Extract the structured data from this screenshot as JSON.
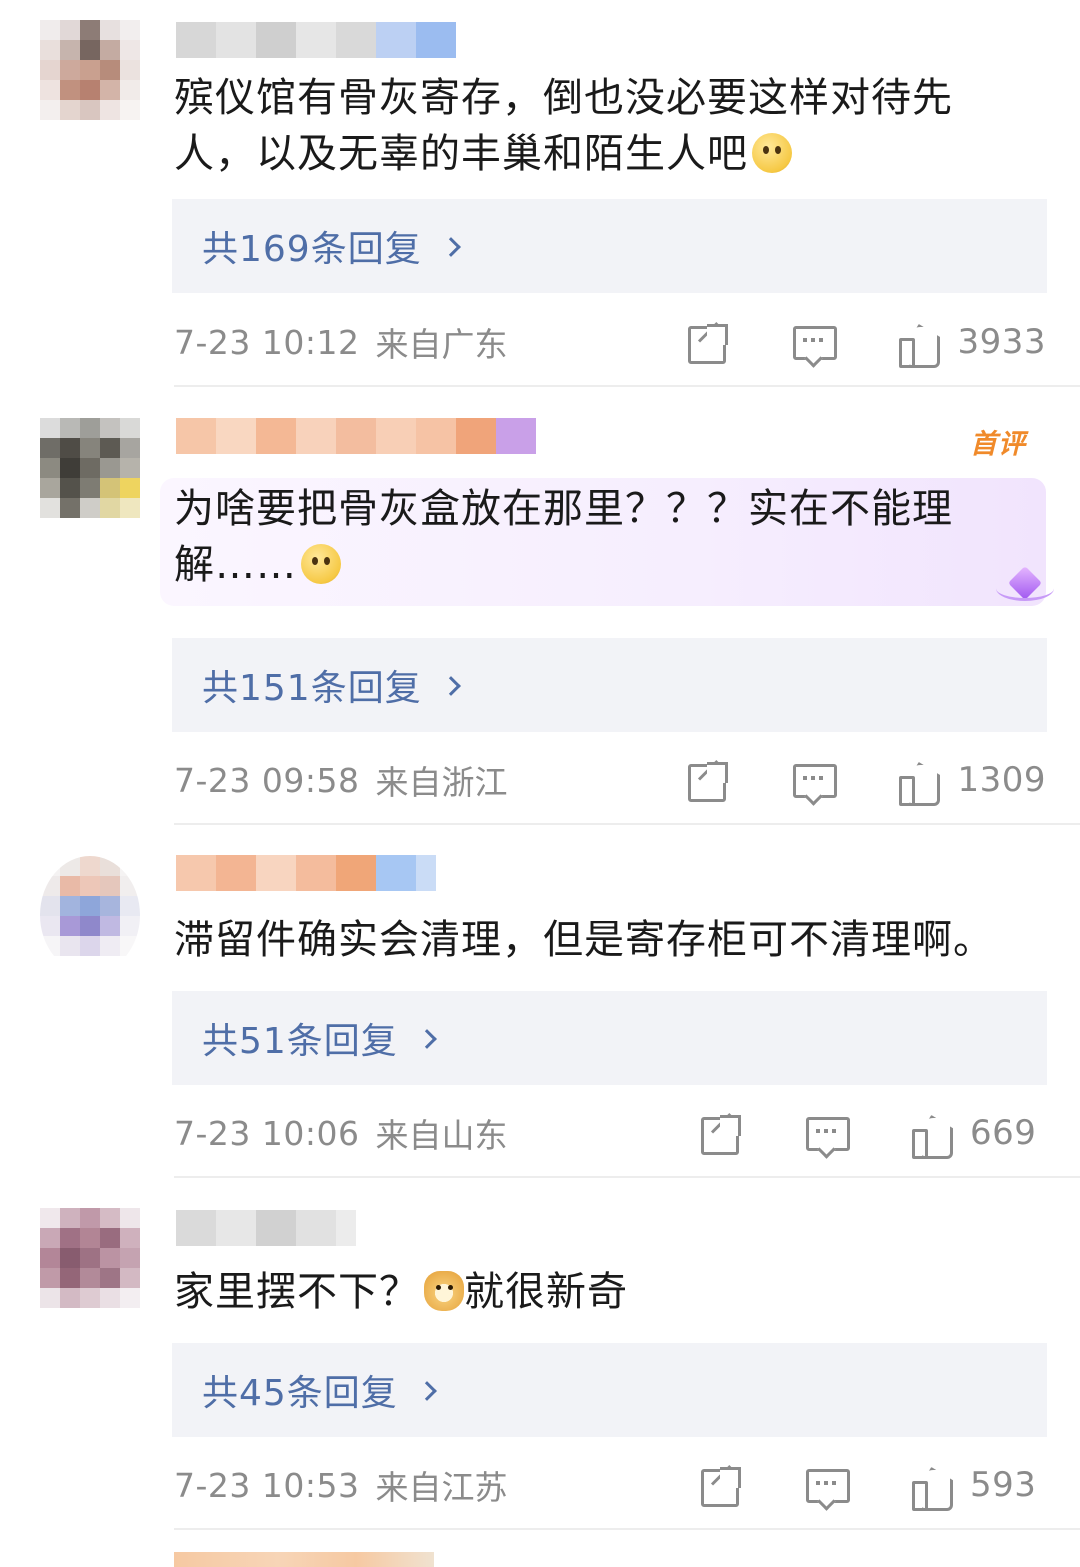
{
  "comments": [
    {
      "text": "殡仪馆有骨灰寄存，倒也没必要这样对待先人，以及无辜的丰巢和陌生人吧",
      "emoji": "thinking-emoji",
      "replies_label": "共169条回复",
      "time": "7-23 10:12",
      "location": "来自广东",
      "likes": "3933"
    },
    {
      "badge": "首评",
      "text": "为啥要把骨灰盒放在那里？？？实在不能理解……",
      "emoji": "thinking-emoji",
      "replies_label": "共151条回复",
      "time": "7-23 09:58",
      "location": "来自浙江",
      "likes": "1309"
    },
    {
      "text": "滞留件确实会清理，但是寄存柜可不清理啊。",
      "replies_label": "共51条回复",
      "time": "7-23 10:06",
      "location": "来自山东",
      "likes": "669"
    },
    {
      "text_before": "家里摆不下？",
      "emoji": "doge-emoji",
      "text_after": "就很新奇",
      "replies_label": "共45条回复",
      "time": "7-23 10:53",
      "location": "来自江苏",
      "likes": "593"
    }
  ],
  "colors": {
    "link": "#4f6ea7",
    "meta": "#8b8b8b",
    "badge": "#f08a2a",
    "reply_bg": "#f2f3f7"
  }
}
